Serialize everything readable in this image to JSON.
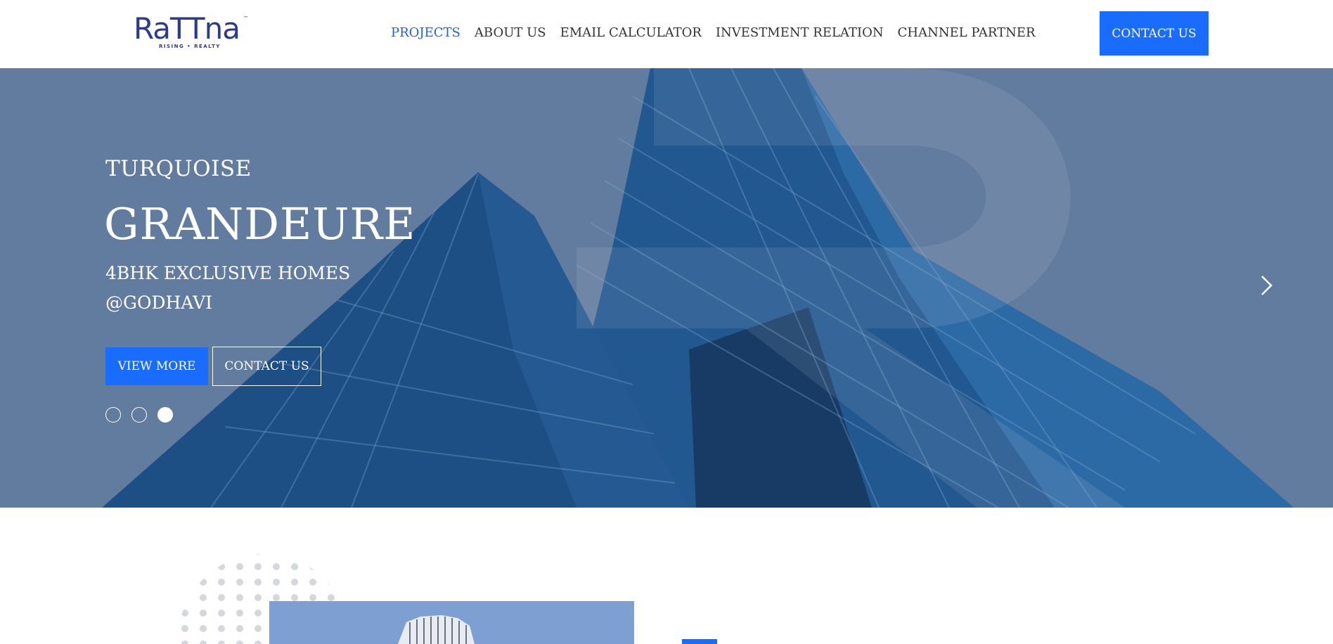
{
  "brand": {
    "logo_text": "RaTTna",
    "tm": "™",
    "tagline": "RISING • REALTY"
  },
  "nav": {
    "items": [
      {
        "label": "PROJECTS",
        "active": true
      },
      {
        "label": "ABOUT US",
        "active": false
      },
      {
        "label": "EMAIL CALCULATOR",
        "active": false
      },
      {
        "label": "INVESTMENT RELATION",
        "active": false
      },
      {
        "label": "CHANNEL PARTNER",
        "active": false
      }
    ],
    "cta_label": "CONTACT US"
  },
  "hero": {
    "kicker": "TURQUOISE",
    "title": "GRANDEURE",
    "subtitle_line1": "4BHK EXCLUSIVE HOMES",
    "subtitle_line2": "@GODHAVI",
    "primary_button": "VIEW MORE",
    "secondary_button": "CONTACT US",
    "slides": {
      "count": 3,
      "active_index": 3
    },
    "next_icon": "chevron-right-icon"
  },
  "colors": {
    "accent": "#1a6cff",
    "active_nav": "#1f5fe0",
    "nav_text": "#333333",
    "brand": "#2b3a8c",
    "hero_overlay": "#6e88a8"
  }
}
